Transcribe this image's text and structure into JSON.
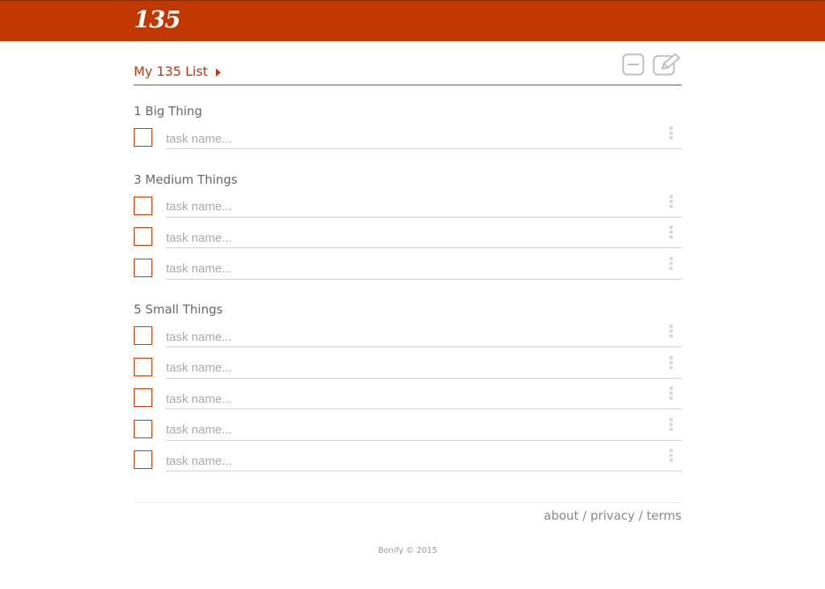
{
  "app": {
    "logo": "135"
  },
  "list": {
    "title": "My 135 List"
  },
  "sections": {
    "big": {
      "title": "1 Big Thing"
    },
    "medium": {
      "title": "3 Medium Things"
    },
    "small": {
      "title": "5 Small Things"
    }
  },
  "task": {
    "placeholder": "task name..."
  },
  "icons": {
    "collapse": "minus-square-icon",
    "edit": "edit-pencil-icon",
    "menu": "drag-handle-dots-icon",
    "list_menu": "caret-right-icon"
  },
  "footer": {
    "about": "about",
    "sep1": " / ",
    "privacy": "privacy",
    "sep2": " / ",
    "terms": "terms",
    "copyright": "Bonify © 2015"
  },
  "colors": {
    "brand": "#c03800",
    "checkbox_border": "#c03800",
    "divider": "#cfcfcf",
    "placeholder": "#aaaaaa"
  }
}
